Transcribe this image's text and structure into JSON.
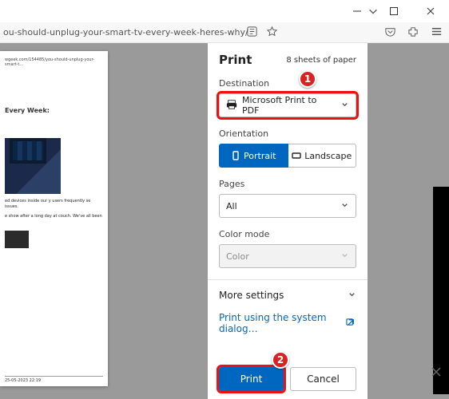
{
  "window": {
    "url_fragment": "ou-should-unplug-your-smart-tv-every-week-heres-why/"
  },
  "preview": {
    "top_url": "wgeek.com/154485/you-should-unplug-your-smart-t...",
    "heading": "Every Week:",
    "para1": "ed devices inside our y users frequently se issues.",
    "para2": "e show after a long day at couch. We've all been",
    "footer_left": "25-05-2023  22:19"
  },
  "dialog": {
    "title": "Print",
    "sheets": "8 sheets of paper",
    "destination_label": "Destination",
    "destination_value": "Microsoft Print to PDF",
    "orientation_label": "Orientation",
    "orientation_portrait": "Portrait",
    "orientation_landscape": "Landscape",
    "pages_label": "Pages",
    "pages_value": "All",
    "color_label": "Color mode",
    "color_value": "Color",
    "more_settings": "More settings",
    "system_dialog": "Print using the system dialog…",
    "print_btn": "Print",
    "cancel_btn": "Cancel"
  },
  "callouts": {
    "c1": "1",
    "c2": "2"
  }
}
